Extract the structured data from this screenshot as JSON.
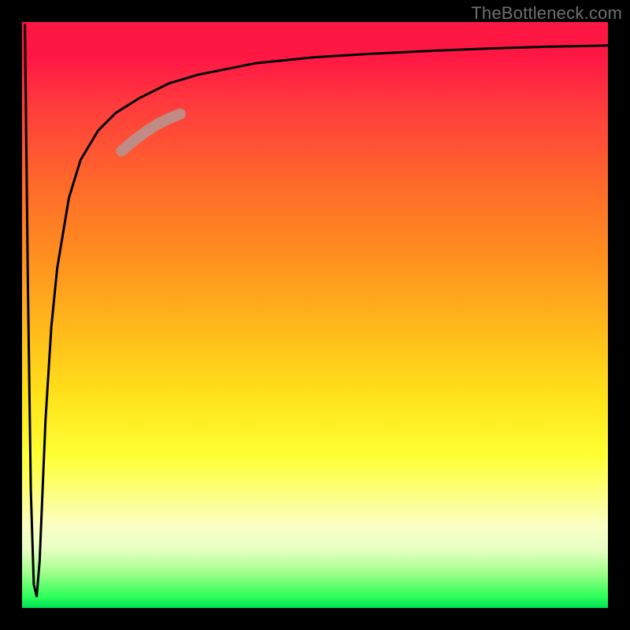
{
  "attribution": "TheBottleneck.com",
  "gradient_colors": {
    "top": "#ff1744",
    "mid_orange": "#ff8f1f",
    "mid_yellow": "#ffe21a",
    "pale_yellow": "#fbffc4",
    "green": "#00e156"
  },
  "chart_data": {
    "type": "line",
    "title": "",
    "xlabel": "",
    "ylabel": "",
    "xlim": [
      0,
      100
    ],
    "ylim": [
      0,
      100
    ],
    "series": [
      {
        "name": "bottleneck-curve",
        "x": [
          0.5,
          1.0,
          1.5,
          2.0,
          2.5,
          3.0,
          3.5,
          4.0,
          5.0,
          6.0,
          8.0,
          10.0,
          13.0,
          16.0,
          20.0,
          25.0,
          30.0,
          40.0,
          50.0,
          60.0,
          70.0,
          80.0,
          90.0,
          100.0
        ],
        "y": [
          99.5,
          55.0,
          20.0,
          4.0,
          2.0,
          8.0,
          20.0,
          32.0,
          48.0,
          58.0,
          70.0,
          76.5,
          81.5,
          84.5,
          87.0,
          89.5,
          91.0,
          93.0,
          94.0,
          94.6,
          95.1,
          95.5,
          95.8,
          96.0
        ]
      },
      {
        "name": "highlight-segment",
        "x": [
          17.0,
          19.0,
          21.0,
          23.0,
          25.0,
          27.0
        ],
        "y": [
          78.0,
          79.7,
          81.2,
          82.5,
          83.5,
          84.3
        ]
      }
    ],
    "highlight_color": "#c08a85",
    "curve_color": "#000000",
    "notch_x": 2.2,
    "notch_y_min": 2.0
  }
}
